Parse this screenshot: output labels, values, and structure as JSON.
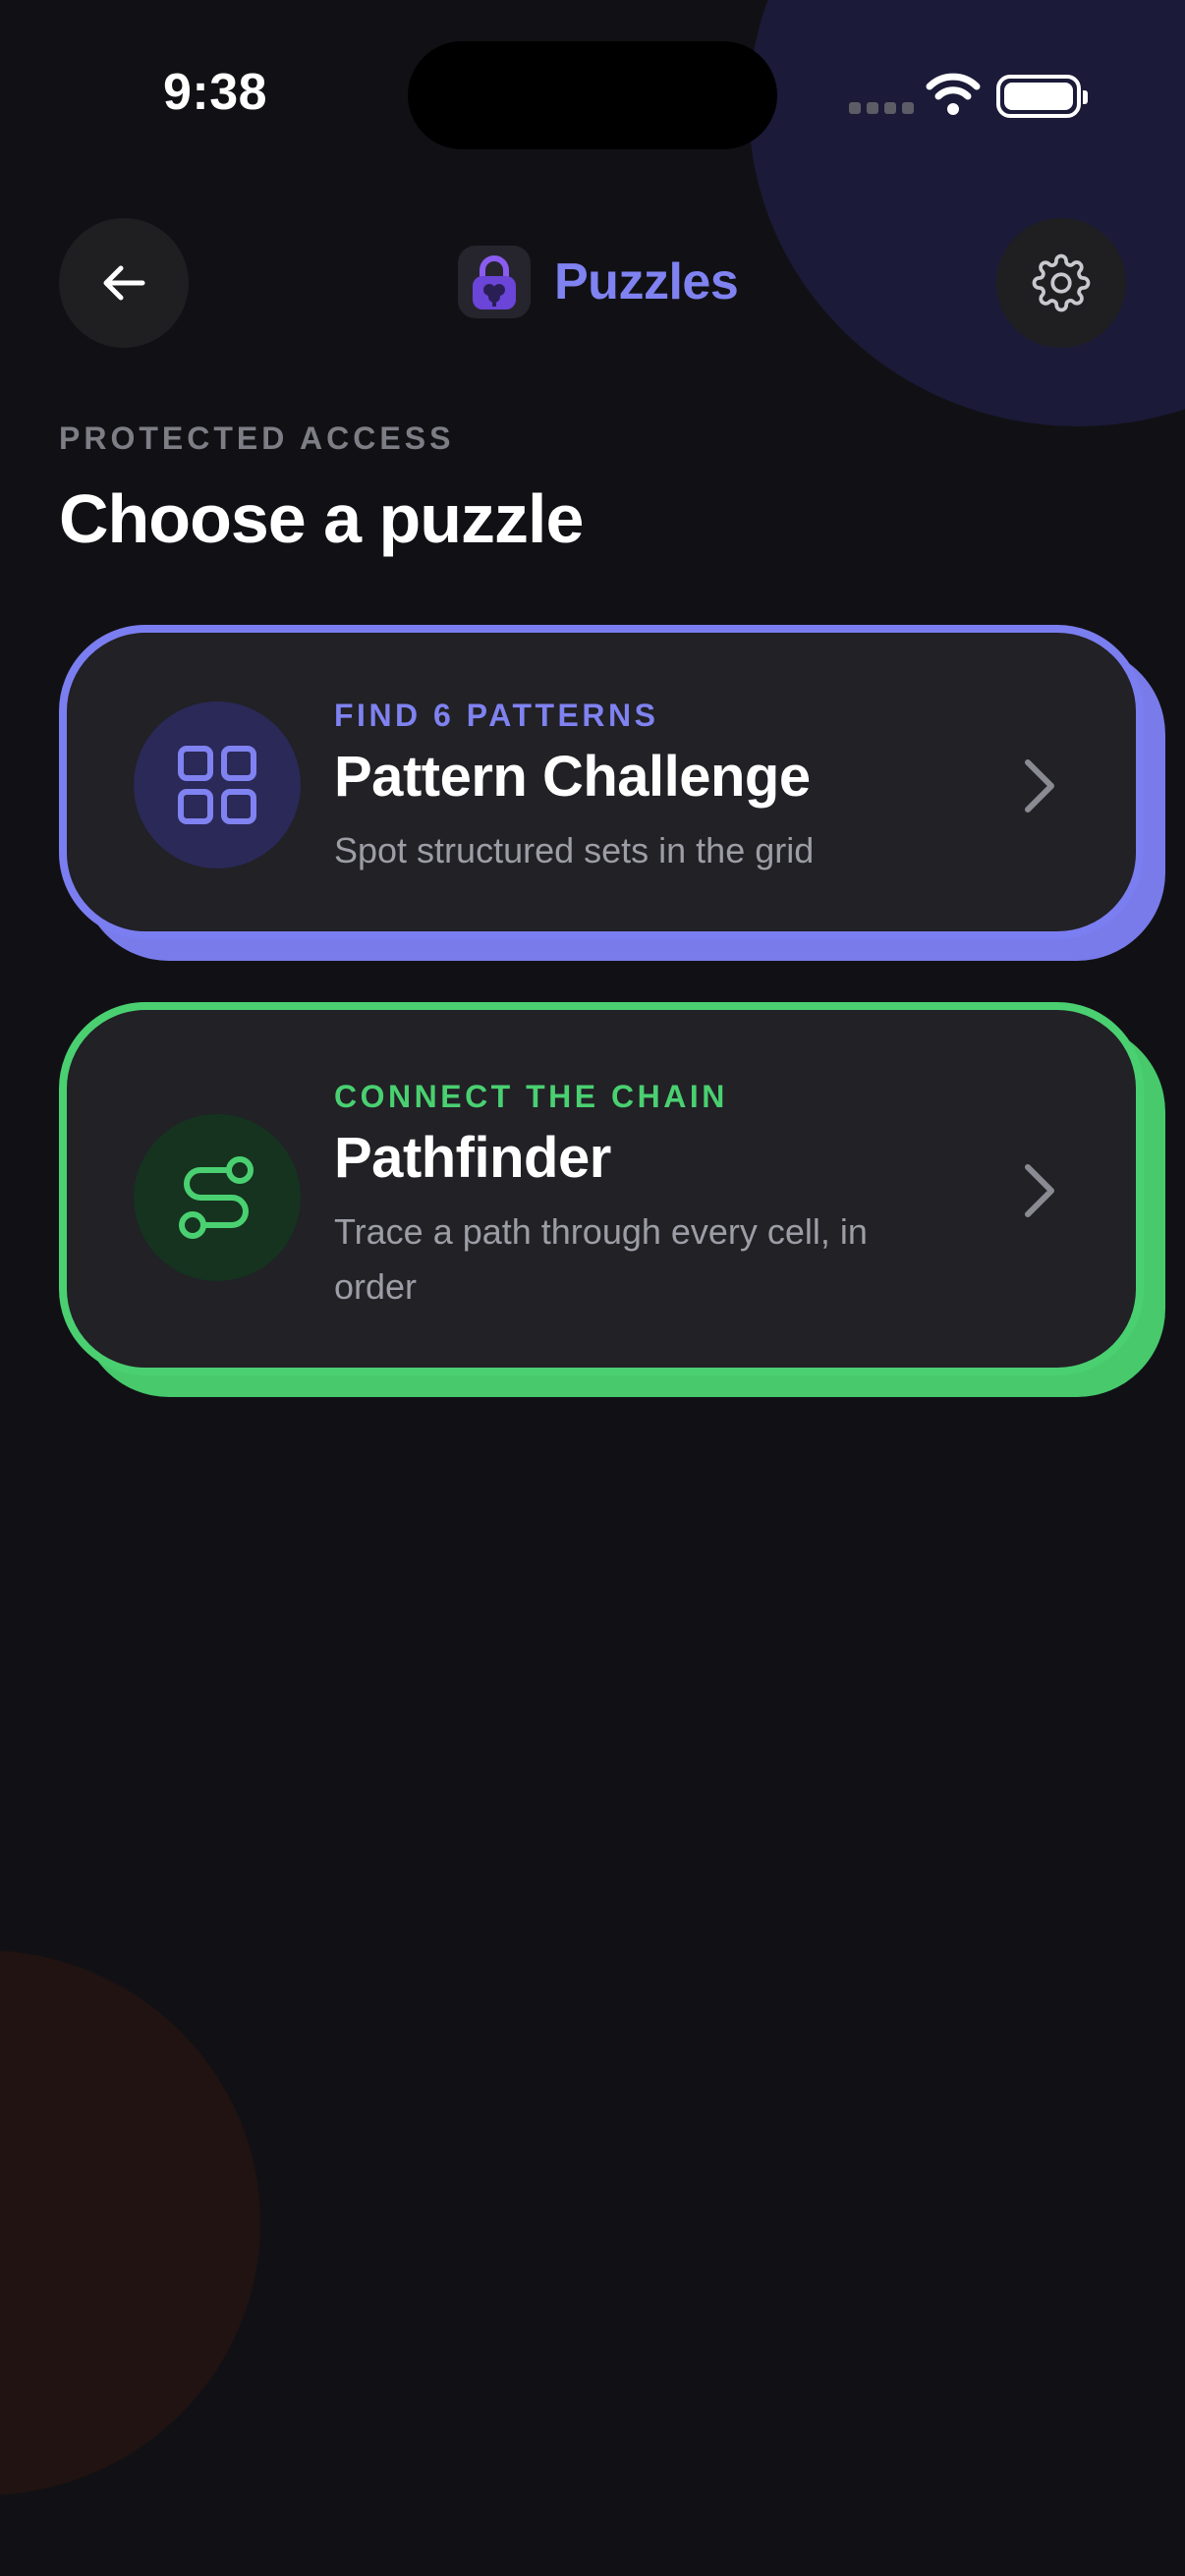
{
  "status_bar": {
    "time": "9:38"
  },
  "header": {
    "title": "Puzzles",
    "back_icon": "arrow-left-icon",
    "settings_icon": "gear-icon",
    "logo_icon": "padlock-brain-icon"
  },
  "kicker": "PROTECTED ACCESS",
  "page_title": "Choose a puzzle",
  "puzzles": [
    {
      "eyebrow": "FIND 6 PATTERNS",
      "title": "Pattern Challenge",
      "description": "Spot structured sets in the grid",
      "icon": "grid-icon",
      "accent": "#7b7ef0"
    },
    {
      "eyebrow": "CONNECT THE CHAIN",
      "title": "Pathfinder",
      "description": "Trace a path through every cell, in order",
      "icon": "route-icon",
      "accent": "#4ad071"
    }
  ],
  "colors": {
    "background": "#111115",
    "card": "#212126",
    "brand": "#7f82f0"
  }
}
